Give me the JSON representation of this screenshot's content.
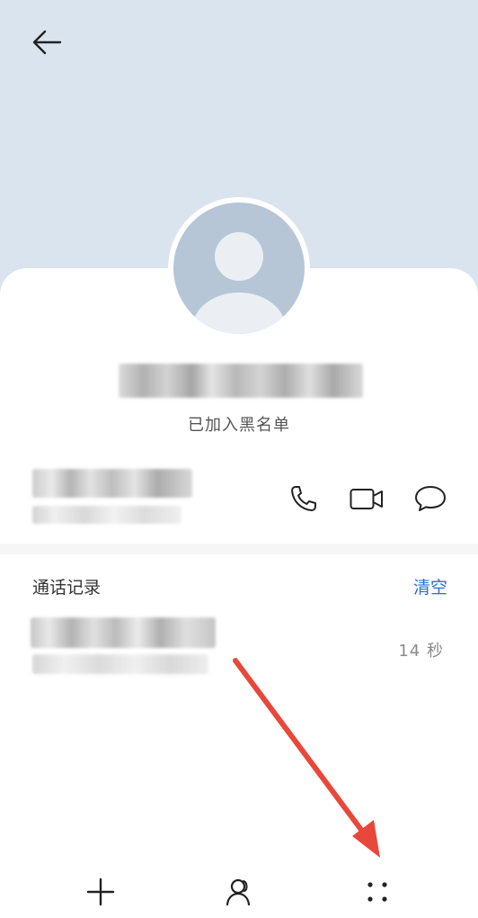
{
  "header": {
    "back_icon": "arrow-left-icon"
  },
  "contact": {
    "avatar_icon": "default-person-avatar",
    "name_obscured": true,
    "status_text": "已加入黑名单",
    "phone_obscured": true,
    "location_obscured": true
  },
  "actions": [
    {
      "icon": "phone-icon"
    },
    {
      "icon": "video-call-icon"
    },
    {
      "icon": "message-icon"
    }
  ],
  "call_log": {
    "title": "通话记录",
    "clear_label": "清空",
    "entries": [
      {
        "name_obscured": true,
        "duration": "14 秒"
      }
    ]
  },
  "bottom_bar": {
    "items": [
      {
        "icon": "plus-icon"
      },
      {
        "icon": "person-icon"
      },
      {
        "icon": "more-dots-icon"
      }
    ]
  },
  "annotation": {
    "arrow_color": "#e8483a"
  },
  "colors": {
    "header_bg": "#dae4ee",
    "avatar_bg": "#b6c6d6",
    "accent": "#2a6fd6"
  }
}
